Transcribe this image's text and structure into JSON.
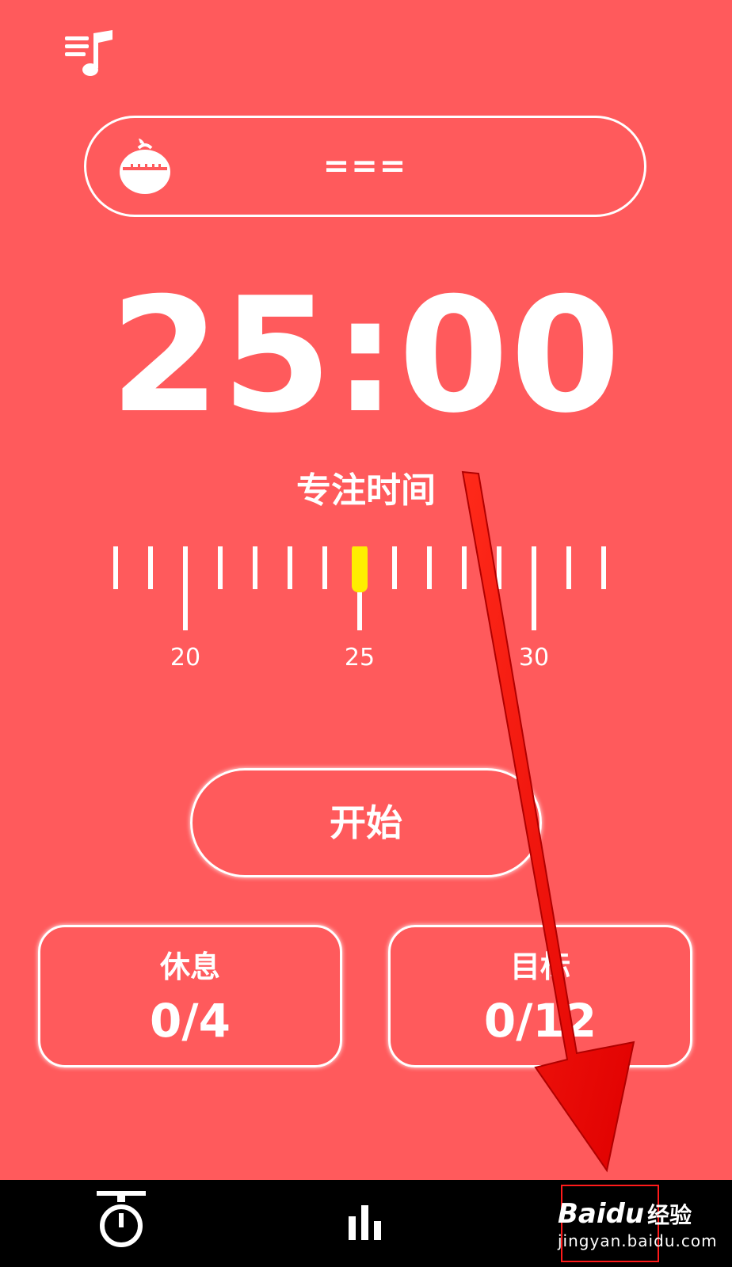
{
  "task": {
    "label": "==="
  },
  "timer": {
    "display": "25:00",
    "mode_label": "专注时间"
  },
  "ruler": {
    "selected_minutes": 25,
    "min_minutes": 18,
    "max_minutes": 32,
    "major_labels": [
      "20",
      "25",
      "30"
    ],
    "indicator_color": "#ffee00"
  },
  "actions": {
    "start_label": "开始"
  },
  "stats": {
    "rest_title": "休息",
    "rest_value": "0/4",
    "goal_title": "目标",
    "goal_value": "0/12"
  },
  "nav": {
    "items": [
      {
        "icon": "stopwatch-icon"
      },
      {
        "icon": "bar-chart-icon"
      },
      {
        "icon": "settings-icon"
      }
    ]
  },
  "watermark": {
    "brand": "Baidu",
    "brand_cn": "经验",
    "url": "jingyan.baidu.com"
  },
  "colors": {
    "background": "#ff5a5c",
    "foreground": "#ffffff",
    "nav_background": "#000000",
    "annotation": "#ff0000"
  }
}
